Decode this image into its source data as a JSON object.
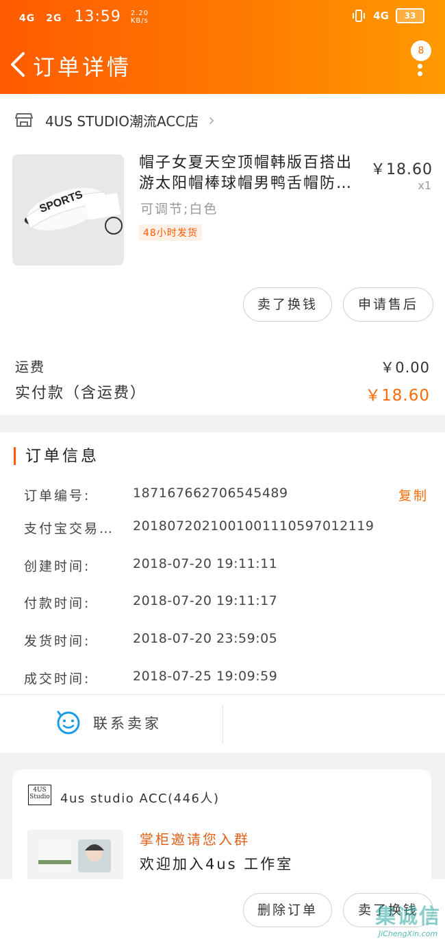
{
  "status_bar": {
    "network1": "4G",
    "network2": "2G",
    "time": "13:59",
    "speed_value": "2.20",
    "speed_unit": "KB/s",
    "network3": "4G",
    "battery": "33"
  },
  "header": {
    "title": "订单详情",
    "message_count": "8"
  },
  "shop": {
    "name": "4US STUDIO潮流ACC店"
  },
  "product": {
    "title": "帽子女夏天空顶帽韩版百搭出游太阳帽棒球帽男鸭舌帽防…",
    "price": "￥18.60",
    "quantity": "x1",
    "sku": "可调节;白色",
    "tag": "48小时发货"
  },
  "actions": {
    "sell_button": "卖了换钱",
    "aftersale_button": "申请售后"
  },
  "fees": {
    "shipping_label": "运费",
    "shipping_value": "￥0.00",
    "paid_label": "实付款（含运费）",
    "paid_value": "￥18.60"
  },
  "order_info": {
    "section_title": "订单信息",
    "copy_label": "复制",
    "rows": [
      {
        "label": "订单编号:",
        "value": "187167662706545489"
      },
      {
        "label": "支付宝交易…",
        "value": "2018072021001001110597012119"
      },
      {
        "label": "创建时间:",
        "value": "2018-07-20 19:11:11"
      },
      {
        "label": "付款时间:",
        "value": "2018-07-20 19:11:17"
      },
      {
        "label": "发货时间:",
        "value": "2018-07-20 23:59:05"
      },
      {
        "label": "成交时间:",
        "value": "2018-07-25 19:09:59"
      }
    ]
  },
  "contact": {
    "label": "联系卖家"
  },
  "group": {
    "logo_line1": "4US",
    "logo_line2": "Studio",
    "name": "4us studio ACC(446人)",
    "invite_text": "掌柜邀请您入群",
    "welcome_text": "欢迎加入4us 工作室"
  },
  "footer": {
    "delete_button": "删除订单",
    "sell_button": "卖了换钱"
  },
  "watermark": {
    "main": "集诚信",
    "site": "JiChengXin.com"
  },
  "colors": {
    "accent": "#ff6a00",
    "price_orange": "#ff6a00"
  }
}
